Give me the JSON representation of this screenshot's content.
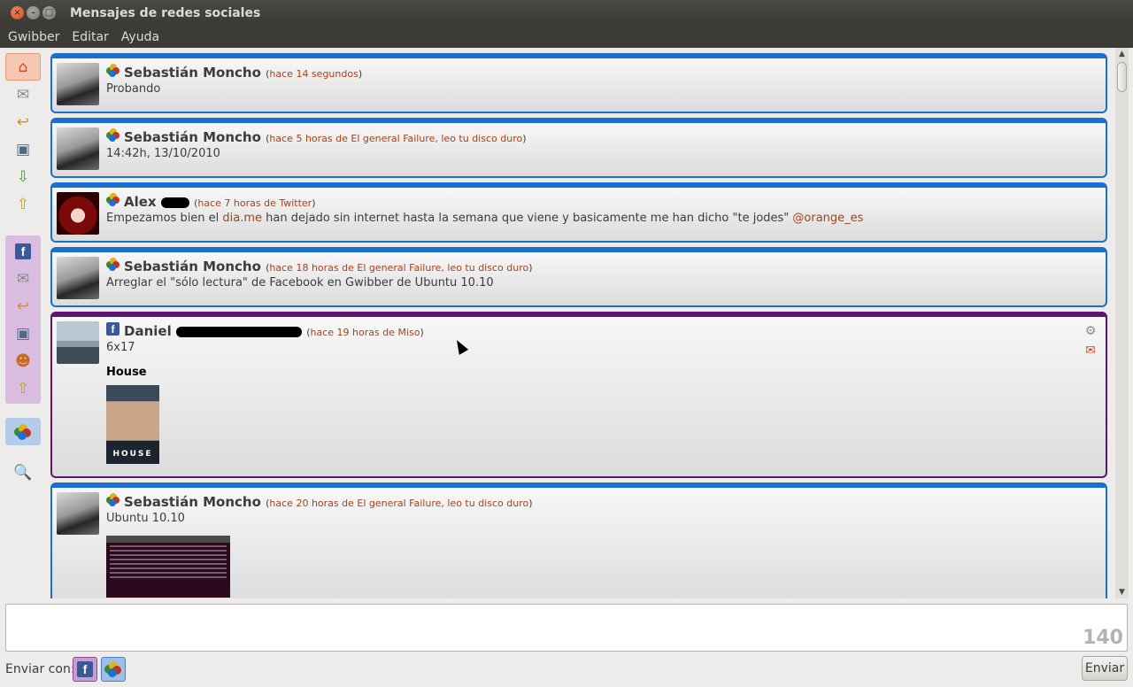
{
  "window": {
    "title": "Mensajes de redes sociales"
  },
  "menu": [
    "Gwibber",
    "Editar",
    "Ayuda"
  ],
  "sidebar": {
    "top_group": [
      "home-icon",
      "messages-icon",
      "replies-icon",
      "images-icon",
      "incoming-icon",
      "outgoing-icon"
    ],
    "facebook_group": [
      "facebook-icon",
      "messages-icon",
      "replies-icon",
      "images-icon",
      "friends-icon",
      "outgoing-icon"
    ],
    "gwibber_group": [
      "gwibber-account-icon"
    ],
    "search_icon": "search-icon"
  },
  "messages": [
    {
      "service": "gwibber",
      "author": "Sebastián Moncho",
      "meta_open": "(",
      "time": "hace 14 segundos",
      "source": "",
      "meta_close": ")",
      "text": "Probando"
    },
    {
      "service": "gwibber",
      "author": "Sebastián Moncho",
      "meta_open": "(",
      "time": "hace 5 horas de El general Failure, leo tu disco duro",
      "source": "",
      "meta_close": ")",
      "text": "14:42h, 13/10/2010"
    },
    {
      "service": "gwibber",
      "author": "Alex",
      "meta_open": "(",
      "time": "hace 7 horas de Twitter",
      "source": "",
      "meta_close": ")",
      "text_before": "Empezamos bien el ",
      "link1": "dia.me",
      "text_middle": " han dejado sin internet hasta la semana que viene y basicamente me han dicho \"te jodes\" ",
      "link2": "@orange_es"
    },
    {
      "service": "gwibber",
      "author": "Sebastián Moncho",
      "meta_open": "(",
      "time": "hace 18 horas de El general Failure, leo tu disco duro",
      "source": "",
      "meta_close": ")",
      "text": "Arreglar el \"sólo lectura\" de Facebook en Gwibber de Ubuntu 10.10"
    },
    {
      "service": "facebook",
      "author": "Daniel",
      "meta_open": "(",
      "time": "hace 19 horas de Miso",
      "source": "",
      "meta_close": ")",
      "text": "6x17",
      "attachment_title": "House",
      "attachment_caption": "HOUSE"
    },
    {
      "service": "gwibber",
      "author": "Sebastián Moncho",
      "meta_open": "(",
      "time": "hace 20 horas de El general Failure, leo tu disco duro",
      "source": "",
      "meta_close": ")",
      "text": "Ubuntu 10.10"
    }
  ],
  "composer": {
    "counter": "140"
  },
  "sendbar": {
    "label": "Enviar con:",
    "send_button": "Enviar"
  },
  "colors": {
    "gwibber_border": "#1c6fcf",
    "facebook_border": "#5e1470",
    "time_link": "#a5421a"
  }
}
